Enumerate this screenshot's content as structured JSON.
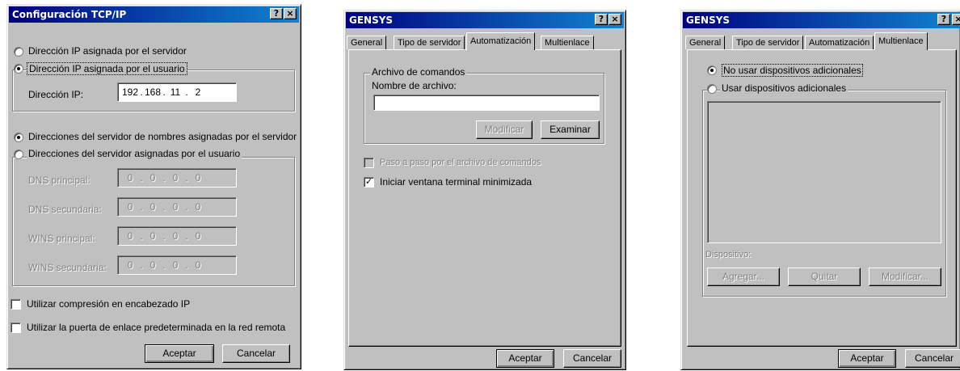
{
  "win1": {
    "title": "Configuración TCP/IP",
    "help_btn": "?",
    "close_btn": "×",
    "radio_ip_server": "Dirección IP asignada por el servidor",
    "radio_ip_user": "Dirección IP asignada por el usuario",
    "ip_label": "Dirección IP:",
    "ip_octets": [
      "192",
      "168",
      "11",
      "2"
    ],
    "radio_dns_server": "Direcciones del servidor de nombres asignadas por el servidor",
    "radio_dns_user": "Direcciones del servidor asignadas por el usuario",
    "dns_rows": [
      {
        "label": "DNS principal:",
        "octets": [
          "0",
          "0",
          "0",
          "0"
        ]
      },
      {
        "label": "DNS secundaria:",
        "octets": [
          "0",
          "0",
          "0",
          "0"
        ]
      },
      {
        "label": "WINS principal:",
        "octets": [
          "0",
          "0",
          "0",
          "0"
        ]
      },
      {
        "label": "WINS secundaria:",
        "octets": [
          "0",
          "0",
          "0",
          "0"
        ]
      }
    ],
    "chk_compress": "Utilizar compresión en encabezado IP",
    "chk_gateway": "Utilizar la puerta de enlace predeterminada en la red remota",
    "ok": "Aceptar",
    "cancel": "Cancelar"
  },
  "win2": {
    "title": "GENSYS",
    "help_btn": "?",
    "close_btn": "×",
    "tabs": [
      "General",
      "Tipo de servidor",
      "Automatización",
      "Multienlace"
    ],
    "group_title": "Archivo de comandos",
    "file_label": "Nombre de archivo:",
    "file_value": "",
    "btn_modify": "Modificar",
    "btn_browse": "Examinar",
    "chk_step": "Paso a paso por el archivo de comandos",
    "chk_minimized": "Iniciar ventana terminal minimizada",
    "ok": "Aceptar",
    "cancel": "Cancelar"
  },
  "win3": {
    "title": "GENSYS",
    "help_btn": "?",
    "close_btn": "×",
    "tabs": [
      "General",
      "Tipo de servidor",
      "Automatización",
      "Multienlace"
    ],
    "radio_no_devices": "No usar dispositivos adicionales",
    "radio_use_devices": "Usar dispositivos adicionales",
    "device_label": "Dispositivo:",
    "btn_add": "Agregar...",
    "btn_remove": "Quitar",
    "btn_modify": "Modificar...",
    "ok": "Aceptar",
    "cancel": "Cancelar"
  }
}
